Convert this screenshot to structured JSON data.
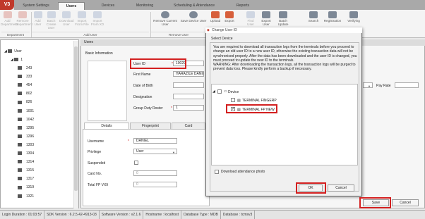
{
  "app": {
    "logo": "V3"
  },
  "menu": {
    "tabs": [
      "System Settings",
      "Users",
      "Devices",
      "Monitoring",
      "Scheduling & Attendance",
      "Reports"
    ],
    "active": "Users"
  },
  "ribbon": {
    "buttons": [
      {
        "label": "Add Department",
        "enabled": false
      },
      {
        "label": "Remove Department",
        "enabled": false
      },
      {
        "label": "Add User",
        "enabled": false
      },
      {
        "label": "Batch Create User",
        "enabled": false
      },
      {
        "label": "Download User",
        "enabled": false
      },
      {
        "label": "Import From File",
        "enabled": false
      },
      {
        "label": "Import From XD",
        "enabled": false
      },
      {
        "label": "Remove Current User",
        "enabled": true
      },
      {
        "label": "Save Device User",
        "enabled": true
      },
      {
        "label": "Upload",
        "enabled": true
      },
      {
        "label": "Export",
        "enabled": true
      },
      {
        "label": "Find User",
        "enabled": false
      },
      {
        "label": "Export User",
        "enabled": true
      },
      {
        "label": "Batch Update",
        "enabled": true
      },
      {
        "label": "Search",
        "enabled": true
      },
      {
        "label": "Registration",
        "enabled": true
      },
      {
        "label": "Verifying",
        "enabled": true
      }
    ],
    "groups": [
      "Department",
      "Add User",
      "Remove User"
    ]
  },
  "tree": {
    "root": "User",
    "dept": "1",
    "items": [
      "243",
      "333",
      "454",
      "802",
      "826",
      "1001",
      "1042",
      "1295",
      "1296",
      "1303",
      "1304",
      "1314",
      "1315",
      "1317",
      "1319",
      "1321"
    ]
  },
  "panel": {
    "title": "Users",
    "basic_info": "Basic Information"
  },
  "form": {
    "user_id_label": "User ID",
    "user_id": "10029",
    "first_name_label": "First Name",
    "first_name": "HARAZILE DANIEL",
    "dob_label": "Date of Birth",
    "designation_label": "Designation",
    "roster_label": "Group Duty Roster",
    "roster": "1",
    "pay_rate_label": "Pay Rate",
    "required": "*"
  },
  "tabs": [
    "Details",
    "Fingerprint",
    "Card"
  ],
  "details": {
    "username_label": "Username",
    "username": "DANIEL",
    "privilege_label": "Privilege",
    "privilege": "User",
    "suspended_label": "Suspended",
    "card_label": "Card No.",
    "card": "0",
    "fp_label": "Total FP VX9",
    "fp": "0"
  },
  "buttons": {
    "save": "Save",
    "cancel": "Cancel"
  },
  "dialog": {
    "title": "Change User ID",
    "section": "Select Device",
    "warning": "You are required to download all transaction logs from the terminals before you proceed to change an old user ID to a new user ID, otherwise the existing transaction data will not be synchronised properly. After the data has been downloaded and the user ID is changed, you must proceed to update the new ID to the terminals.\nWARNING: After downloading the transaction logs, all the transaction logs will be purged to prevent data loss. Please kindly perform a backup if necessary.",
    "tree_root": "Device",
    "devices": [
      {
        "name": "TERMINAL FINGERP",
        "checked": false
      },
      {
        "name": "TERMINAL FP NEW",
        "checked": true
      }
    ],
    "download_label": "Download attendance photo",
    "ok": "OK",
    "cancel": "Cancel"
  },
  "status": {
    "duration": "Login Duration : 01:03:57",
    "sdk": "SDK Version : 6.2.5.42-4913-03",
    "software": "Software Version : v2.1.6",
    "hostname": "Hostname : localhost",
    "dbtype": "Database Type : MDB",
    "db": "Database : tcmsv3"
  },
  "colors": {
    "highlight": "#d32020",
    "menubar": "#a9a9a9"
  }
}
